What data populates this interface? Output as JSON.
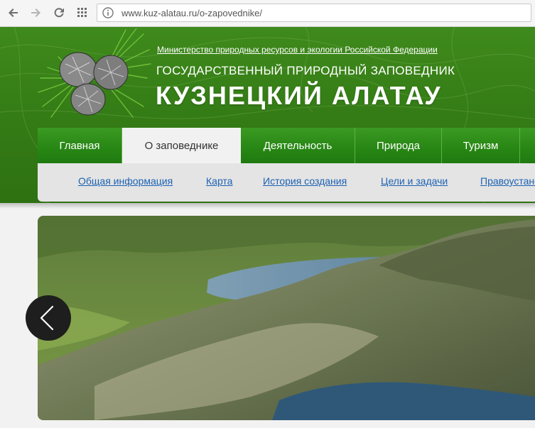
{
  "browser": {
    "url": "www.kuz-alatau.ru/o-zapovednike/"
  },
  "header": {
    "ministry": "Министерство природных ресурсов и экологии Российской Федерации",
    "subtitle": "ГОСУДАРСТВЕННЫЙ ПРИРОДНЫЙ ЗАПОВЕДНИК",
    "title": "КУЗНЕЦКИЙ АЛАТАУ"
  },
  "menu": {
    "items": [
      {
        "label": "Главная"
      },
      {
        "label": "О заповеднике"
      },
      {
        "label": "Деятельность"
      },
      {
        "label": "Природа"
      },
      {
        "label": "Туризм"
      }
    ]
  },
  "submenu": {
    "links": [
      {
        "label": "Общая информация"
      },
      {
        "label": "Карта"
      },
      {
        "label": "История создания"
      },
      {
        "label": "Цели и задачи"
      },
      {
        "label": "Правоустановл"
      }
    ]
  },
  "colors": {
    "header_green": "#357d16",
    "menu_green": "#278614",
    "link_blue": "#1d62b3"
  },
  "icons": [
    "back-arrow-icon",
    "forward-arrow-icon",
    "reload-icon",
    "apps-grid-icon",
    "page-info-icon",
    "chevron-left-icon",
    "pine-cones-logo"
  ]
}
